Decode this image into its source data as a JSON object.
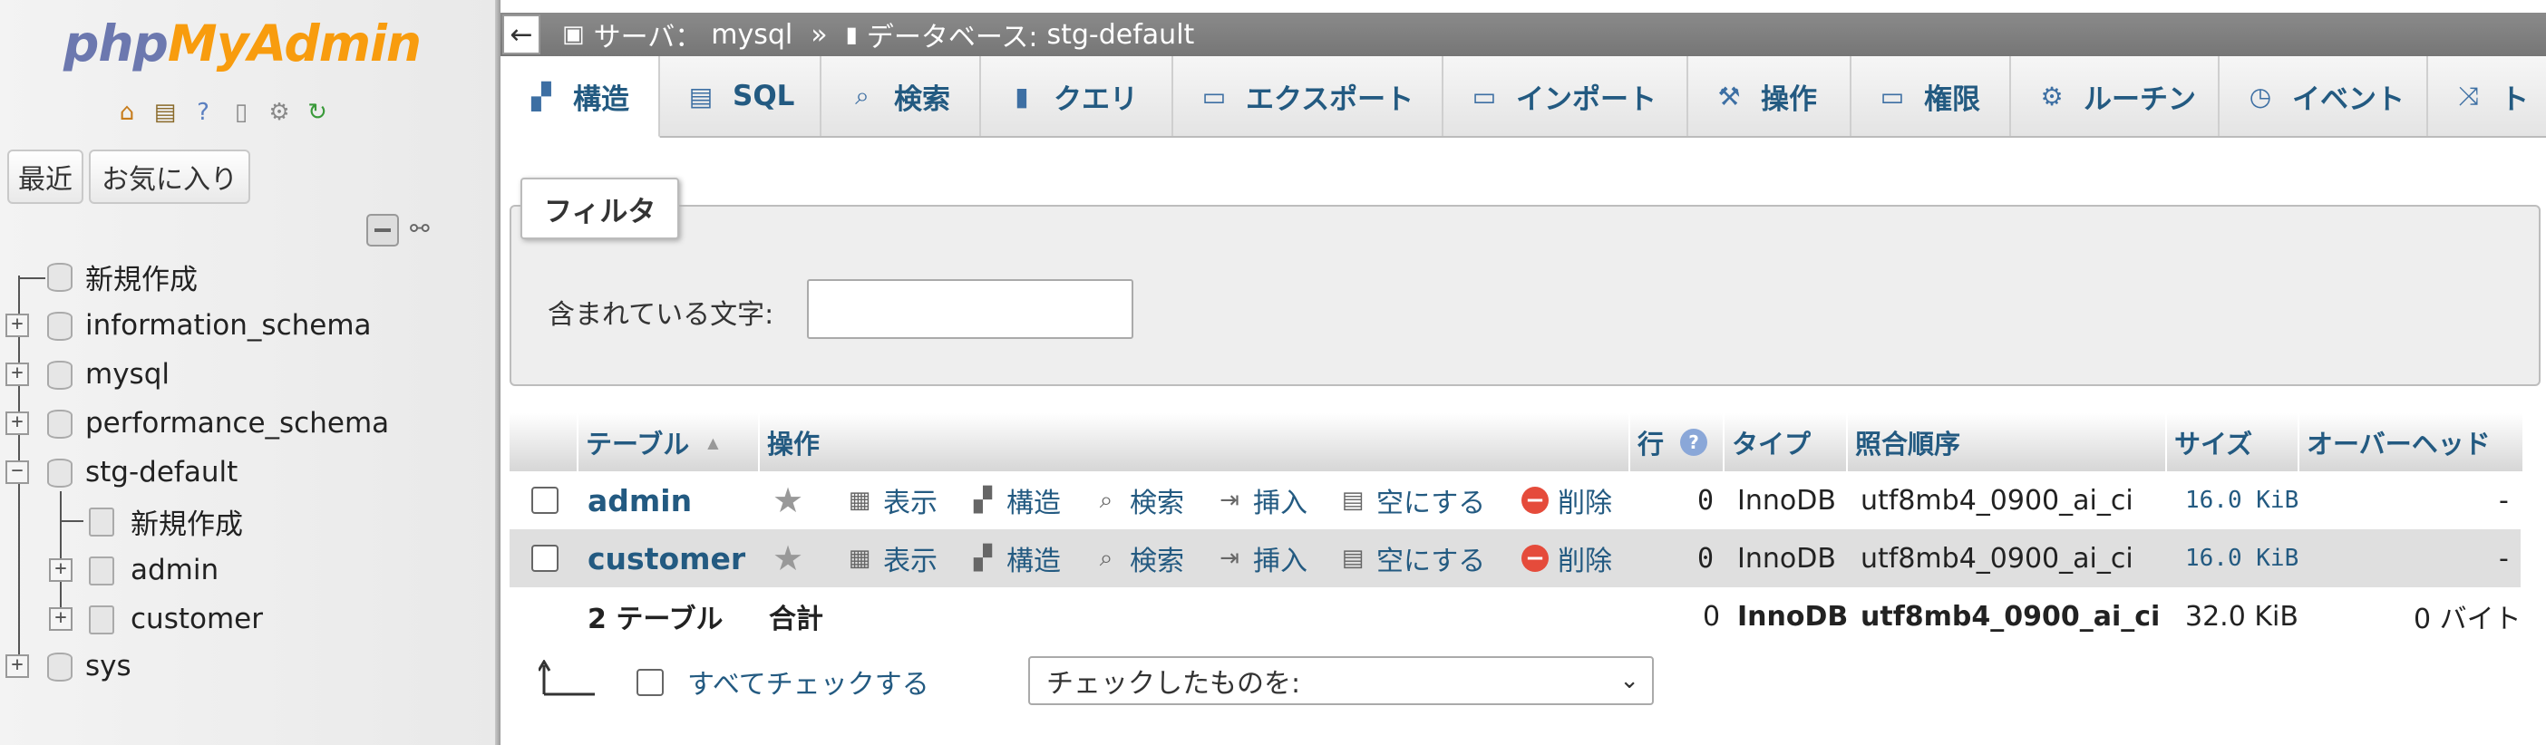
{
  "app": {
    "logo_php": "php",
    "logo_myadmin": "MyAdmin"
  },
  "nav": {
    "tabs": [
      "最近",
      "お気に入り"
    ],
    "icons": [
      "home-icon",
      "logout-icon",
      "help-icon",
      "docs-icon",
      "settings-icon",
      "reload-icon"
    ],
    "tree": {
      "new": "新規作成",
      "databases": [
        "information_schema",
        "mysql",
        "performance_schema",
        "stg-default",
        "sys"
      ],
      "expanded_db": "stg-default",
      "expanded_new": "新規作成",
      "expanded_tables": [
        "admin",
        "customer"
      ]
    }
  },
  "breadcrumb": {
    "server_label": "サーバ：",
    "server_name": "mysql",
    "sep": "»",
    "db_label": "データベース:",
    "db_name": "stg-default"
  },
  "menu": {
    "tabs": [
      "構造",
      "SQL",
      "検索",
      "クエリ",
      "エクスポート",
      "インポート",
      "操作",
      "権限",
      "ルーチン",
      "イベント",
      "ト"
    ],
    "active": "構造"
  },
  "filter": {
    "legend": "フィルタ",
    "label": "含まれている文字:",
    "value": ""
  },
  "table": {
    "headers": {
      "table": "テーブル",
      "sort_indicator": "▲",
      "actions": "操作",
      "rows": "行",
      "type": "タイプ",
      "collation": "照合順序",
      "size": "サイズ",
      "overhead": "オーバーヘッド"
    },
    "actions": {
      "browse": "表示",
      "structure": "構造",
      "search": "検索",
      "insert": "挿入",
      "empty": "空にする",
      "drop": "削除"
    },
    "rows": [
      {
        "name": "admin",
        "rows": "0",
        "type": "InnoDB",
        "collation": "utf8mb4_0900_ai_ci",
        "size": "16.0 KiB",
        "overhead": "-"
      },
      {
        "name": "customer",
        "rows": "0",
        "type": "InnoDB",
        "collation": "utf8mb4_0900_ai_ci",
        "size": "16.0 KiB",
        "overhead": "-"
      }
    ],
    "footer": {
      "count": "2 テーブル",
      "label": "合計",
      "rows": "0",
      "type": "InnoDB",
      "collation": "utf8mb4_0900_ai_ci",
      "size": "32.0 KiB",
      "overhead": "0 バイト"
    }
  },
  "bottom": {
    "check_all": "すべてチェックする",
    "with_selected": "チェックしたものを:"
  }
}
